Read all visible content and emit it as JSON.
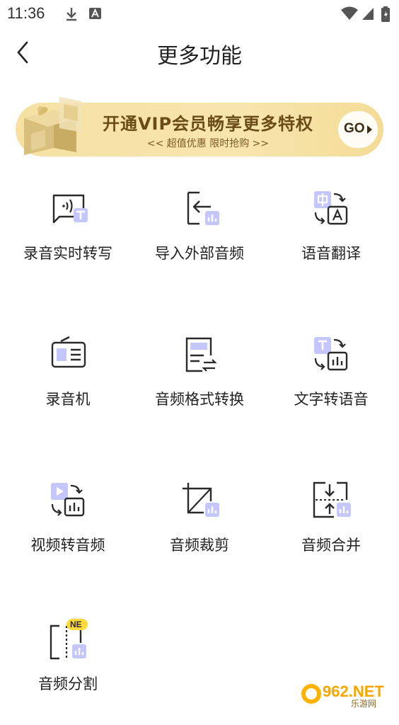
{
  "status_bar": {
    "time": "11:36"
  },
  "header": {
    "title": "更多功能"
  },
  "banner": {
    "title": "开通VIP会员畅享更多特权",
    "subtitle": "<< 超值优惠  限时抢购 >>",
    "go_label": "GO"
  },
  "features": [
    {
      "label": "录音实时转写",
      "icon": "speech-to-text-icon"
    },
    {
      "label": "导入外部音频",
      "icon": "import-audio-icon"
    },
    {
      "label": "语音翻译",
      "icon": "translate-icon"
    },
    {
      "label": "录音机",
      "icon": "recorder-icon"
    },
    {
      "label": "音频格式转换",
      "icon": "audio-format-convert-icon"
    },
    {
      "label": "文字转语音",
      "icon": "text-to-speech-icon"
    },
    {
      "label": "视频转音频",
      "icon": "video-to-audio-icon"
    },
    {
      "label": "音频裁剪",
      "icon": "audio-crop-icon"
    },
    {
      "label": "音频合并",
      "icon": "audio-merge-icon"
    },
    {
      "label": "音频分割",
      "icon": "audio-split-icon",
      "badge": "NE"
    }
  ],
  "watermark": {
    "text": "962.NET",
    "subtext": "乐游网"
  },
  "colors": {
    "accent_light": "#c5c6fb",
    "icon_stroke": "#2a2a2a",
    "banner_bg": "#f6e1a3",
    "badge_yellow": "#ffd83a"
  }
}
